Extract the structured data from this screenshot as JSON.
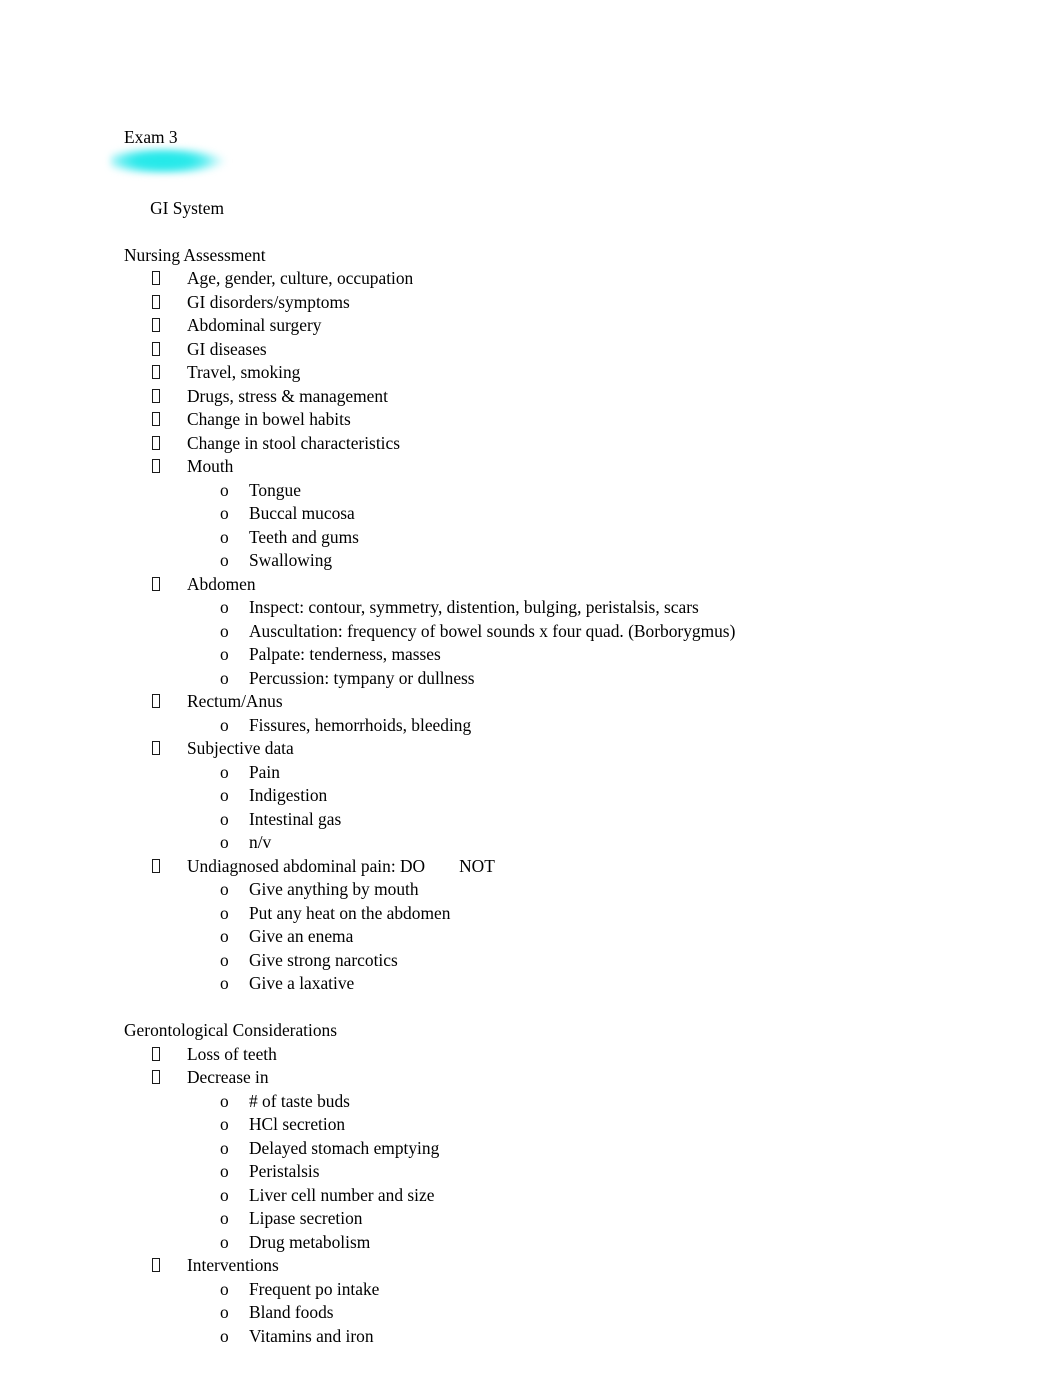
{
  "document": {
    "title_line": "Exam 3",
    "highlighted_heading": "GI System",
    "highlight_color": "#22E9E9",
    "text_color": "#000000",
    "background_color": "#FFFFFF",
    "level1_bullet_glyph": "missing-glyph-box",
    "level2_bullet_glyph": "o"
  },
  "sections": [
    {
      "heading": "Nursing Assessment",
      "items": [
        {
          "level": 1,
          "text": "Age, gender, culture, occupation"
        },
        {
          "level": 1,
          "text": "GI disorders/symptoms"
        },
        {
          "level": 1,
          "text": "Abdominal surgery"
        },
        {
          "level": 1,
          "text": "GI diseases"
        },
        {
          "level": 1,
          "text": "Travel, smoking"
        },
        {
          "level": 1,
          "text": "Drugs, stress & management"
        },
        {
          "level": 1,
          "text": "Change in bowel habits"
        },
        {
          "level": 1,
          "text": "Change in stool characteristics"
        },
        {
          "level": 1,
          "text": "Mouth"
        },
        {
          "level": 2,
          "text": "Tongue"
        },
        {
          "level": 2,
          "text": "Buccal mucosa"
        },
        {
          "level": 2,
          "text": "Teeth and gums"
        },
        {
          "level": 2,
          "text": "Swallowing"
        },
        {
          "level": 1,
          "text": "Abdomen"
        },
        {
          "level": 2,
          "text": "Inspect: contour, symmetry, distention, bulging, peristalsis, scars"
        },
        {
          "level": 2,
          "text": "Auscultation: frequency of bowel sounds x four quad. (Borborygmus)"
        },
        {
          "level": 2,
          "text": "Palpate: tenderness, masses"
        },
        {
          "level": 2,
          "text": "Percussion: tympany or dullness"
        },
        {
          "level": 1,
          "text": "Rectum/Anus"
        },
        {
          "level": 2,
          "text": "Fissures, hemorrhoids, bleeding"
        },
        {
          "level": 1,
          "text": "Subjective data"
        },
        {
          "level": 2,
          "text": "Pain"
        },
        {
          "level": 2,
          "text": "Indigestion"
        },
        {
          "level": 2,
          "text": "Intestinal gas"
        },
        {
          "level": 2,
          "text": "n/v"
        },
        {
          "level": 1,
          "text": "Undiagnosed abdominal pain: DO",
          "text_after_tab": "NOT"
        },
        {
          "level": 2,
          "text": "Give anything by mouth"
        },
        {
          "level": 2,
          "text": "Put any heat on the abdomen"
        },
        {
          "level": 2,
          "text": "Give an enema"
        },
        {
          "level": 2,
          "text": "Give strong narcotics"
        },
        {
          "level": 2,
          "text": "Give a laxative"
        }
      ]
    },
    {
      "heading": "Gerontological Considerations",
      "items": [
        {
          "level": 1,
          "text": "Loss of teeth"
        },
        {
          "level": 1,
          "text": "Decrease in"
        },
        {
          "level": 2,
          "text": "# of taste buds"
        },
        {
          "level": 2,
          "text": "HCl secretion"
        },
        {
          "level": 2,
          "text": "Delayed stomach emptying"
        },
        {
          "level": 2,
          "text": "Peristalsis"
        },
        {
          "level": 2,
          "text": "Liver cell number and size"
        },
        {
          "level": 2,
          "text": "Lipase secretion"
        },
        {
          "level": 2,
          "text": "Drug metabolism"
        },
        {
          "level": 1,
          "text": "Interventions"
        },
        {
          "level": 2,
          "text": "Frequent po intake"
        },
        {
          "level": 2,
          "text": "Bland foods"
        },
        {
          "level": 2,
          "text": "Vitamins and iron"
        }
      ]
    }
  ]
}
